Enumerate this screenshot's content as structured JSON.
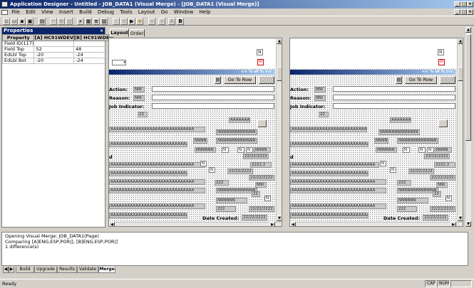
{
  "window": {
    "title": "Application Designer - Untitled - JOB_DATA1 (Visual Merge) - [JOB_DATA1 (Visual Merge)]"
  },
  "menu": [
    "File",
    "Edit",
    "View",
    "Insert",
    "Build",
    "Debug",
    "Tools",
    "Layout",
    "Go",
    "Window",
    "Help"
  ],
  "properties": {
    "title": "Properties",
    "columns": [
      "Property",
      "[A] HC91WDEV",
      "[B] HC91WDEV"
    ],
    "rows": [
      [
        "Field ID(117)",
        "",
        ""
      ],
      [
        "Field Top",
        "52",
        "48"
      ],
      [
        "EdLbl Top",
        "-20",
        "-24"
      ],
      [
        "EdLbl Bot",
        "-20",
        "-24"
      ]
    ]
  },
  "editor_tabs": [
    "Layout",
    "Order"
  ],
  "page": {
    "nav_text": "<< % of % >>",
    "go_to_row": "Go To Row",
    "labels": {
      "action": "Action:",
      "reason": "Reason:",
      "job_indicator": "Job Indicator:",
      "date_created": "Date Created:"
    },
    "n": "N",
    "nnn": "NNNNNNNNNNNNN",
    "nnnn": "NNNN",
    "nnnnnn": "NNNNNN",
    "aaa": "AAAAAAAAAAAAAAAAAAAAAAAAAAAAAA",
    "aaaaaaa": "AAAAAAA",
    "d22": "22",
    "d222": "222",
    "date": "22/22/2222",
    "num": "2222.2",
    "nni": "NNI",
    "nni2": "NNI"
  },
  "output": {
    "lines": [
      "Opening Visual Merge: JOB_DATA1(Page)",
      "Comparing [A]ENG,ESP,POR|], [B]ENG,ESP,POR|]",
      "1 difference(s)"
    ],
    "tabs": [
      "Build",
      "Upgrade",
      "Results",
      "Validate",
      "Merge"
    ]
  },
  "status": {
    "text": "Ready",
    "cap": "CAP",
    "num": "NUM"
  }
}
